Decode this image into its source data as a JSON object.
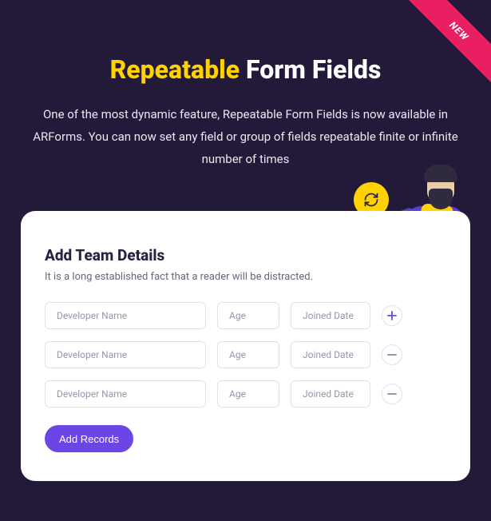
{
  "ribbon": {
    "label": "NEW"
  },
  "hero": {
    "title_accent": "Repeatable",
    "title_rest": " Form Fields",
    "description": "One of the most dynamic feature, Repeatable Form Fields is now available in ARForms. You can now set any field or group of fields repeatable finite or infinite number of times"
  },
  "card": {
    "title": "Add Team Details",
    "subtitle": "It is a long established fact that a reader will be distracted.",
    "rows": [
      {
        "name_ph": "Developer Name",
        "age_ph": "Age",
        "date_ph": "Joined Date",
        "action": "add"
      },
      {
        "name_ph": "Developer Name",
        "age_ph": "Age",
        "date_ph": "Joined Date",
        "action": "remove"
      },
      {
        "name_ph": "Developer Name",
        "age_ph": "Age",
        "date_ph": "Joined Date",
        "action": "remove"
      }
    ],
    "add_button": "Add Records"
  },
  "colors": {
    "accent_yellow": "#ffd200",
    "primary_purple": "#6b46e5",
    "ribbon_pink": "#e91e63",
    "bg_dark": "#231a3a"
  }
}
